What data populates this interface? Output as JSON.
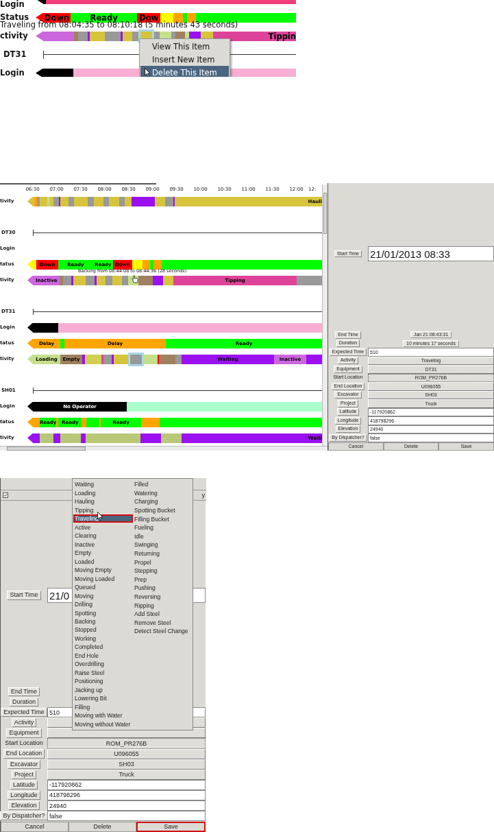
{
  "snippet": {
    "rows": [
      {
        "kind": "bar",
        "label": "Login",
        "segments": [
          {
            "color": "#000000"
          },
          {
            "color": "#f03c78"
          }
        ]
      },
      {
        "kind": "bar",
        "label": "Status",
        "segments": [
          {
            "color": "#ff0000",
            "label": "Down"
          },
          {
            "color": "#00ff00",
            "label": "Ready"
          },
          {
            "color": "#ff0000",
            "label": "Dow"
          },
          {
            "color": "#ffff00"
          },
          {
            "color": "#ffa500"
          },
          {
            "color": "#00ff00"
          },
          {
            "color": "#ffa500"
          },
          {
            "color": "#00ff00"
          }
        ]
      },
      {
        "kind": "bar",
        "label": "ctivity",
        "tooltip": "Traveling from 08:04:35 to 08:10:18 (5 minutes 43 seconds)",
        "segments": [
          {
            "color": "#cc66dd",
            "selected": false
          },
          {
            "color": "#a08060",
            "selected": false
          },
          {
            "color": "#999999",
            "selected": false
          },
          {
            "color": "#9b10f0",
            "selected": false
          },
          {
            "color": "#d6c53c",
            "selected": false
          },
          {
            "color": "#999999",
            "selected": false
          },
          {
            "color": "#9b10f0",
            "selected": false
          },
          {
            "color": "#d6c53c",
            "selected": false
          },
          {
            "color": "#999999",
            "selected": false
          },
          {
            "color": "#d6c53c",
            "selected": true
          },
          {
            "color": "#999999",
            "selected": false
          },
          {
            "color": "#c4e08a",
            "selected": false
          },
          {
            "color": "#999999",
            "selected": false
          },
          {
            "color": "#a08060",
            "selected": false
          },
          {
            "color": "#c4e08a",
            "selected": false
          },
          {
            "color": "#9b10f0",
            "selected": false
          },
          {
            "color": "#d6c53c",
            "selected": false
          },
          {
            "color": "#dd4499",
            "label": "Tippin",
            "selected": false
          }
        ]
      },
      {
        "kind": "line",
        "label": "DT31"
      },
      {
        "kind": "bar",
        "label": "Login",
        "segments": [
          {
            "color": "#000000"
          },
          {
            "color": "#f8aed4"
          }
        ]
      }
    ],
    "context_menu": {
      "items": [
        {
          "label": "View This Item",
          "selected": false
        },
        {
          "label": "Insert New Item",
          "selected": false
        },
        {
          "label": "Delete This Item",
          "selected": true
        }
      ]
    }
  },
  "timeline": {
    "times": [
      "06:30",
      "07:00",
      "07:30",
      "08:00",
      "08:30",
      "09:00",
      "09:30",
      "10:00",
      "10:30",
      "11:00",
      "11:30",
      "12:00",
      "12:"
    ],
    "rows": [
      {
        "kind": "bar",
        "label": "tivity",
        "segments": [
          {
            "color": "#d6c53c"
          },
          {
            "color": "#ffa500"
          },
          {
            "color": "#999999"
          },
          {
            "color": "#d6c53c"
          },
          {
            "color": "#c4e08a"
          },
          {
            "color": "#d6c53c"
          },
          {
            "color": "#999999"
          },
          {
            "color": "#9b10f0"
          },
          {
            "color": "#d6c53c"
          },
          {
            "color": "#999999"
          },
          {
            "color": "#d6c53c"
          },
          {
            "color": "#999999"
          },
          {
            "color": "#d6c53c"
          },
          {
            "color": "#999999"
          },
          {
            "color": "#d6c53c"
          },
          {
            "color": "#999999"
          },
          {
            "color": "#d6c53c"
          },
          {
            "color": "#9b10f0"
          },
          {
            "color": "#d6c53c"
          },
          {
            "color": "#999999"
          },
          {
            "color": "#9b10f0"
          },
          {
            "color": "#d6c53c",
            "label": "Hauli"
          }
        ]
      },
      {
        "kind": "line",
        "label": "DT30"
      },
      {
        "kind": "bar",
        "label": "Login"
      },
      {
        "kind": "bar",
        "label": "tatus",
        "segments": [
          {
            "color": "#ffff00"
          },
          {
            "color": "#ff0000",
            "label": "Down"
          },
          {
            "color": "#00ff00",
            "label": "Ready"
          },
          {
            "color": "#00ff00",
            "label": "Ready"
          },
          {
            "color": "#ff0000",
            "label": "Down"
          },
          {
            "color": "#ffff00"
          },
          {
            "color": "#ffa500"
          },
          {
            "color": "#00ff00"
          },
          {
            "color": "#ffa500"
          },
          {
            "color": "#00ff00"
          }
        ]
      },
      {
        "kind": "bar",
        "label": "tivity",
        "tooltip": "Backing from 08:44:08 to 08:44:36 (28 seconds)",
        "segments": [
          {
            "color": "#cc66dd",
            "label": "Inactive"
          },
          {
            "color": "#a08060"
          },
          {
            "color": "#999999"
          },
          {
            "color": "#9b10f0"
          },
          {
            "color": "#d6c53c"
          },
          {
            "color": "#999999"
          },
          {
            "color": "#9b10f0"
          },
          {
            "color": "#d6c53c"
          },
          {
            "color": "#999999"
          },
          {
            "color": "#d6c53c"
          },
          {
            "color": "#999999"
          },
          {
            "color": "#c4e08a"
          },
          {
            "color": "#a08060"
          },
          {
            "color": "#9b10f0"
          },
          {
            "color": "#d6c53c"
          },
          {
            "color": "#dd4499",
            "label": "Tipping"
          },
          {
            "color": "#999999"
          }
        ]
      },
      {
        "kind": "line",
        "label": "DT31"
      },
      {
        "kind": "bar",
        "label": "Login",
        "segments": [
          {
            "color": "#000000"
          },
          {
            "color": "#f8aed4"
          }
        ]
      },
      {
        "kind": "bar",
        "label": "tatus",
        "segments": [
          {
            "color": "#ffa500",
            "label": "Delay"
          },
          {
            "color": "#00ff00"
          },
          {
            "color": "#ffa500",
            "label": "Delay"
          },
          {
            "color": "#00ff00",
            "label": "Ready"
          }
        ]
      },
      {
        "kind": "bar",
        "label": "tivity",
        "segments": [
          {
            "color": "#c4e08a",
            "label": "Loading",
            "selected": false
          },
          {
            "color": "#a08060",
            "label": "Empty",
            "selected": false
          },
          {
            "color": "#9b10f0",
            "selected": false
          },
          {
            "color": "#d0d050",
            "selected": false
          },
          {
            "color": "#dd4499",
            "selected": false
          },
          {
            "color": "#999999",
            "selected": false
          },
          {
            "color": "#9b10f0",
            "selected": false
          },
          {
            "color": "#d6c53c",
            "selected": false
          },
          {
            "color": "#999999",
            "selected": true
          },
          {
            "color": "#c4e08a",
            "selected": false
          },
          {
            "color": "#ff0000",
            "selected": false
          },
          {
            "color": "#a08060",
            "selected": false
          },
          {
            "color": "#999999",
            "selected": false
          },
          {
            "color": "#9b10f0",
            "label": "Waiting",
            "selected": false
          },
          {
            "color": "#cc66dd",
            "label": "Inactive",
            "selected": false
          },
          {
            "color": "#9b10f0",
            "selected": false
          }
        ]
      },
      {
        "kind": "line",
        "label": "SH01"
      },
      {
        "kind": "bar",
        "label": "Login",
        "segments": [
          {
            "color": "#000000",
            "label": "No Operator"
          },
          {
            "color": "#aaffcc"
          }
        ]
      },
      {
        "kind": "bar",
        "label": "tatus",
        "segments": [
          {
            "color": "#ffa500"
          },
          {
            "color": "#00ff00",
            "label": "Ready"
          },
          {
            "color": "#ffa500"
          },
          {
            "color": "#00ff00",
            "label": "Ready"
          },
          {
            "color": "#ffa500"
          },
          {
            "color": "#00ff00"
          },
          {
            "color": "#ffa500"
          },
          {
            "color": "#00ff00",
            "label": "Ready"
          },
          {
            "color": "#ffa500"
          },
          {
            "color": "#00ff00"
          }
        ]
      },
      {
        "kind": "bar",
        "label": "tivity",
        "segments": [
          {
            "color": "#9b10f0"
          },
          {
            "color": "#b8c878"
          },
          {
            "color": "#9b10f0"
          },
          {
            "color": "#b8c878"
          },
          {
            "color": "#9b10f0"
          },
          {
            "color": "#b8c878"
          },
          {
            "color": "#9b10f0"
          },
          {
            "color": "#b8c878"
          },
          {
            "color": "#9b10f0",
            "label": "Waiti"
          }
        ]
      }
    ]
  },
  "detail": {
    "start_time": {
      "label": "Start Time",
      "value": "21/01/2013 08:33"
    },
    "rows": [
      {
        "kind": "info",
        "label": "End Time",
        "value": "Jan 21 08:43:31"
      },
      {
        "kind": "info",
        "label": "Duration",
        "value": "10 minutes 17 seconds"
      },
      {
        "kind": "input",
        "label": "Expected Time",
        "value": "510"
      },
      {
        "kind": "select",
        "label": "Activity",
        "value": "Traveling",
        "focused": false
      },
      {
        "kind": "select",
        "label": "Equipment",
        "value": "DT31",
        "focused": false
      },
      {
        "kind": "select",
        "label": "Start Location",
        "value": "ROM_PR276B",
        "focused": true
      },
      {
        "kind": "select",
        "label": "End Location",
        "value": "U096055",
        "focused": false
      },
      {
        "kind": "select",
        "label": "Excavator",
        "value": "SH03",
        "focused": false
      },
      {
        "kind": "select",
        "label": "Project",
        "value": "Truck",
        "focused": false
      },
      {
        "kind": "input",
        "label": "Latitude",
        "value": "-117920862"
      },
      {
        "kind": "input",
        "label": "Longitude",
        "value": "418798296"
      },
      {
        "kind": "input",
        "label": "Elevation",
        "value": "24940"
      },
      {
        "kind": "input",
        "label": "By Dispatcher?",
        "value": "false"
      }
    ],
    "buttons": [
      {
        "label": "Cancel",
        "outlined": false
      },
      {
        "label": "Delete",
        "outlined": false
      },
      {
        "label": "Save",
        "outlined": false
      }
    ]
  },
  "edit_form": {
    "header": {
      "checked": true,
      "fragment": "y"
    },
    "start_time": {
      "label": "Start Time",
      "value": "21/0"
    },
    "rows": [
      {
        "kind": "info",
        "label": "End Time"
      },
      {
        "kind": "info",
        "label": "Duration"
      },
      {
        "kind": "input",
        "label": "Expected Time",
        "value": "510"
      },
      {
        "kind": "select",
        "label": "Activity",
        "focused": false
      },
      {
        "kind": "select",
        "label": "Equipment",
        "focused": false
      },
      {
        "kind": "select",
        "label": "Start Location",
        "value": "ROM_PR276B",
        "focused": true
      },
      {
        "kind": "select",
        "label": "End Location",
        "value": "U096055",
        "focused": false
      },
      {
        "kind": "select",
        "label": "Excavator",
        "value": "SH03",
        "focused": false
      },
      {
        "kind": "select",
        "label": "Project",
        "value": "Truck",
        "focused": false
      },
      {
        "kind": "input",
        "label": "Latitude",
        "value": "-117920862"
      },
      {
        "kind": "input",
        "label": "Longitude",
        "value": "418798296"
      },
      {
        "kind": "input",
        "label": "Elevation",
        "value": "24940"
      },
      {
        "kind": "input",
        "label": "By Dispatcher?",
        "value": "false"
      }
    ],
    "buttons": [
      {
        "label": "Cancel",
        "outlined": false
      },
      {
        "label": "Delete",
        "outlined": false
      },
      {
        "label": "Save",
        "outlined": true
      }
    ],
    "dropdown": {
      "columns": [
        [
          {
            "label": "Waiting",
            "selected": false
          },
          {
            "label": "Loading",
            "selected": false
          },
          {
            "label": "Hauling",
            "selected": false
          },
          {
            "label": "Tipping",
            "selected": false
          },
          {
            "label": "Traveling",
            "selected": true
          },
          {
            "label": "Active",
            "selected": false
          },
          {
            "label": "Clearing",
            "selected": false
          },
          {
            "label": "Inactive",
            "selected": false
          },
          {
            "label": "Empty",
            "selected": false
          },
          {
            "label": "Loaded",
            "selected": false
          },
          {
            "label": "Moving Empty",
            "selected": false
          },
          {
            "label": "Moving Loaded",
            "selected": false
          },
          {
            "label": "Queued",
            "selected": false
          },
          {
            "label": "Moving",
            "selected": false
          },
          {
            "label": "Drilling",
            "selected": false
          },
          {
            "label": "Spotting",
            "selected": false
          },
          {
            "label": "Backing",
            "selected": false
          },
          {
            "label": "Stopped",
            "selected": false
          },
          {
            "label": "Working",
            "selected": false
          },
          {
            "label": "Completed",
            "selected": false
          },
          {
            "label": "End Hole",
            "selected": false
          },
          {
            "label": "Overdrilling",
            "selected": false
          },
          {
            "label": "Raise Steel",
            "selected": false
          },
          {
            "label": "Positioning",
            "selected": false
          },
          {
            "label": "Jacking up",
            "selected": false
          },
          {
            "label": "Lowering Bit",
            "selected": false
          },
          {
            "label": "Filling",
            "selected": false
          },
          {
            "label": "Moving with Water",
            "selected": false
          },
          {
            "label": "Moving without Water",
            "selected": false
          }
        ],
        [
          {
            "label": "Filled",
            "selected": false
          },
          {
            "label": "Watering",
            "selected": false
          },
          {
            "label": "Charging",
            "selected": false
          },
          {
            "label": "Spotting Bucket",
            "selected": false
          },
          {
            "label": "Filling Bucket",
            "selected": false
          },
          {
            "label": "Fueling",
            "selected": false
          },
          {
            "label": "Idle",
            "selected": false
          },
          {
            "label": "Swinging",
            "selected": false
          },
          {
            "label": "Returning",
            "selected": false
          },
          {
            "label": "Propel",
            "selected": false
          },
          {
            "label": "Stepping",
            "selected": false
          },
          {
            "label": "Prep",
            "selected": false
          },
          {
            "label": "Pushing",
            "selected": false
          },
          {
            "label": "Reversing",
            "selected": false
          },
          {
            "label": "Ripping",
            "selected": false
          },
          {
            "label": "Add Steel",
            "selected": false
          },
          {
            "label": "Remove Steel",
            "selected": false
          },
          {
            "label": "Detect Steel Change",
            "selected": false
          }
        ]
      ]
    }
  }
}
